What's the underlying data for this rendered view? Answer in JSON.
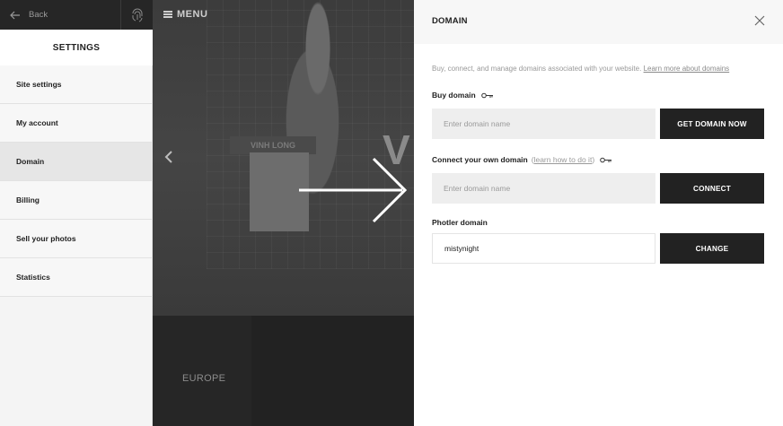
{
  "sidebar": {
    "back_label": "Back",
    "title": "SETTINGS",
    "items": [
      {
        "label": "Site settings"
      },
      {
        "label": "My account"
      },
      {
        "label": "Domain",
        "active": true
      },
      {
        "label": "Billing"
      },
      {
        "label": "Sell your photos"
      },
      {
        "label": "Statistics"
      }
    ]
  },
  "background": {
    "menu_label": "MENU",
    "sign_text": "VINH LONG",
    "big_letter": "V",
    "tile_label": "EUROPE"
  },
  "panel": {
    "title": "DOMAIN",
    "intro_text": "Buy, connect, and manage domains associated with your website.",
    "intro_link": "Learn more about domains",
    "buy": {
      "label": "Buy domain",
      "placeholder": "Enter domain name",
      "button": "GET DOMAIN NOW"
    },
    "connect": {
      "label": "Connect your own domain",
      "how_link": "learn how to do it",
      "placeholder": "Enter domain name",
      "button": "CONNECT"
    },
    "photler": {
      "label": "Photler domain",
      "value": "mistynight",
      "button": "CHANGE"
    }
  },
  "colors": {
    "button_bg": "#222222",
    "input_bg": "#eeeeee",
    "header_bg": "#f7f7f7",
    "active_item_bg": "#e6e6e6",
    "top_bar_bg": "#262626"
  },
  "icons": [
    "back-arrow-icon",
    "fingerprint-icon",
    "hamburger-icon",
    "chevron-left-icon",
    "close-icon",
    "key-icon"
  ]
}
